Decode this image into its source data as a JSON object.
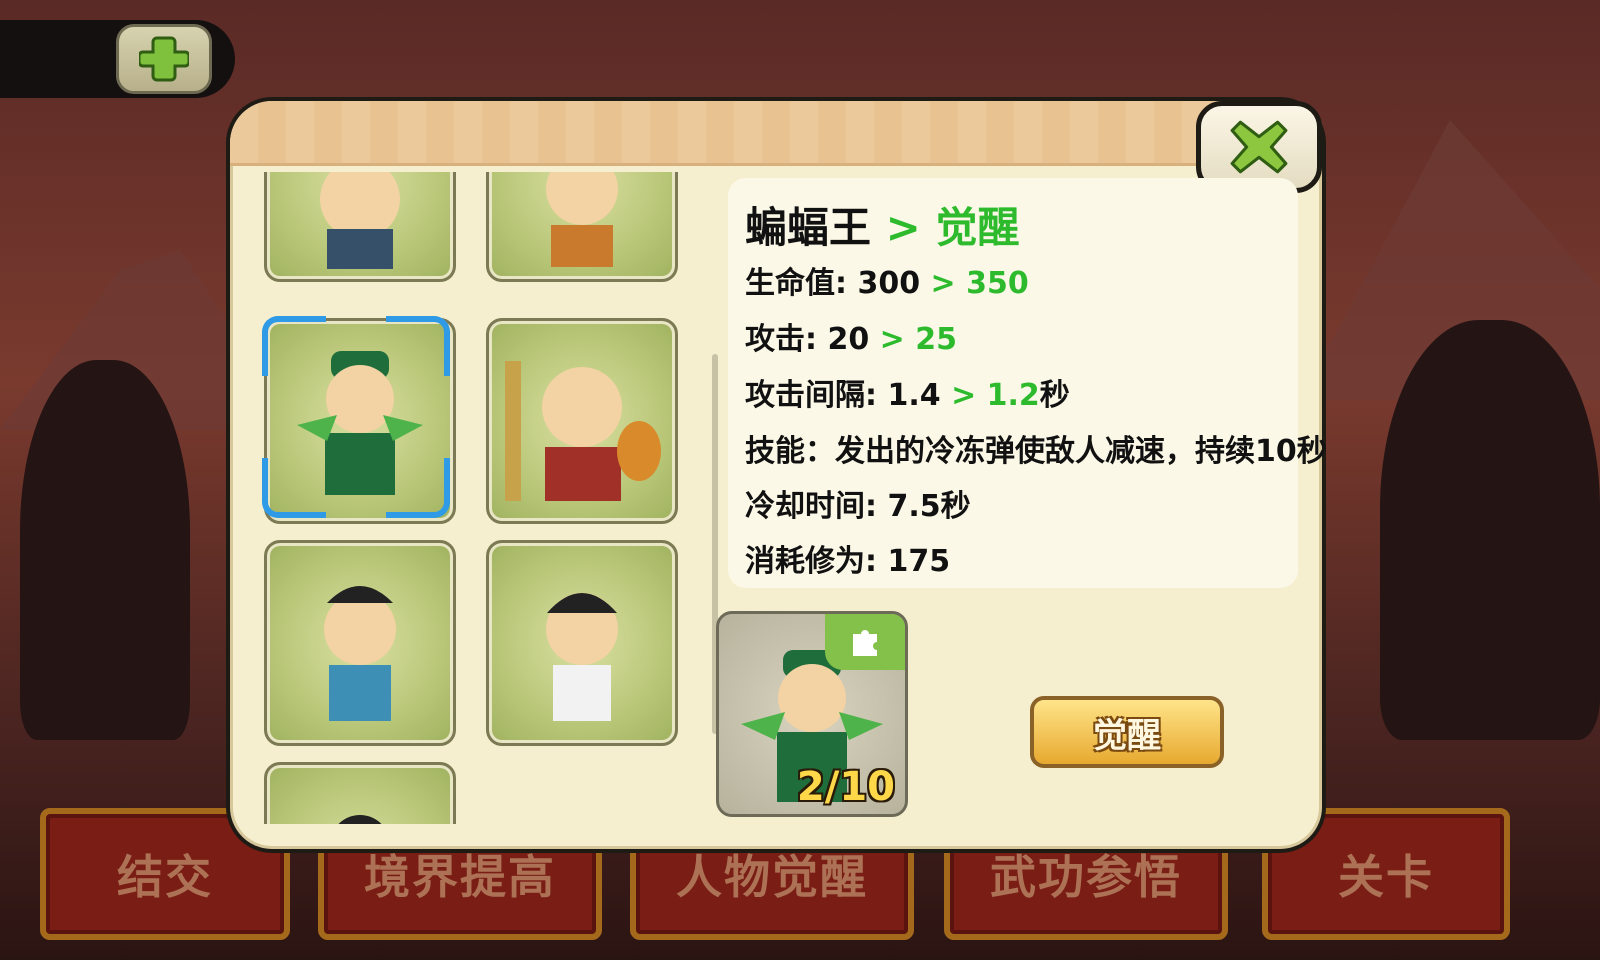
{
  "tabs": [
    {
      "label": "结交"
    },
    {
      "label": "境界提高"
    },
    {
      "label": "人物觉醒"
    },
    {
      "label": "武功参悟"
    },
    {
      "label": "关卡"
    }
  ],
  "hero": {
    "name": "蝙蝠王",
    "upgrade_label": "> 觉醒",
    "stats": [
      {
        "label": "生命值: ",
        "from": "300",
        "to": "> 350",
        "suffix": ""
      },
      {
        "label": "攻击: ",
        "from": "20",
        "to": "> 25",
        "suffix": ""
      },
      {
        "label": "攻击间隔: ",
        "from": "1.4",
        "to": "> 1.2",
        "suffix": "秒"
      }
    ],
    "skill": "技能：发出的冷冻弹使敌人减速，持续10秒",
    "cooldown": "冷却时间: 7.5秒",
    "cost": "消耗修为: 175"
  },
  "awaken": {
    "fragments": "2/10",
    "button_label": "觉醒"
  },
  "colors": {
    "upgrade_green": "#2dbb2d",
    "selection_blue": "#2f9ae6"
  }
}
